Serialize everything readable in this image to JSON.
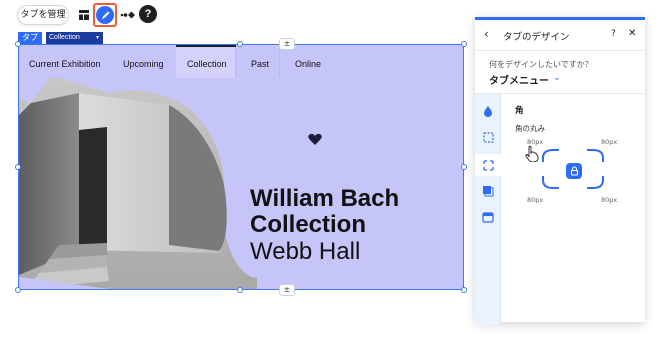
{
  "toolbar": {
    "manage_label": "タブを管理",
    "help_label": "?",
    "icons": [
      "layout-icon",
      "design-brush-icon",
      "animation-icon",
      "help-icon"
    ]
  },
  "element_tag": {
    "type_label": "タブ",
    "selected_tab": "Collection"
  },
  "widget": {
    "tabs": [
      {
        "label": "Current Exhibition",
        "active": false
      },
      {
        "label": "Upcoming",
        "active": false
      },
      {
        "label": "Collection",
        "active": true
      },
      {
        "label": "Past",
        "active": false
      },
      {
        "label": "Online",
        "active": false
      }
    ],
    "headline_line1": "William Bach",
    "headline_line2": "Collection",
    "subline": "Webb Hall",
    "background_color": "#c6c5fa",
    "tab_bar_color": "#c6c5fa"
  },
  "panel": {
    "title": "タブのデザイン",
    "help_label": "?",
    "close_label": "✕",
    "question": "何をデザインしたいですか？",
    "target": "タブメニュー",
    "section_title": "角",
    "section_subtitle": "角の丸み",
    "corners": {
      "top_left": "80px",
      "top_right": "80px",
      "bottom_left": "80px",
      "bottom_right": "80px"
    },
    "accent": "#2f6cf5"
  }
}
